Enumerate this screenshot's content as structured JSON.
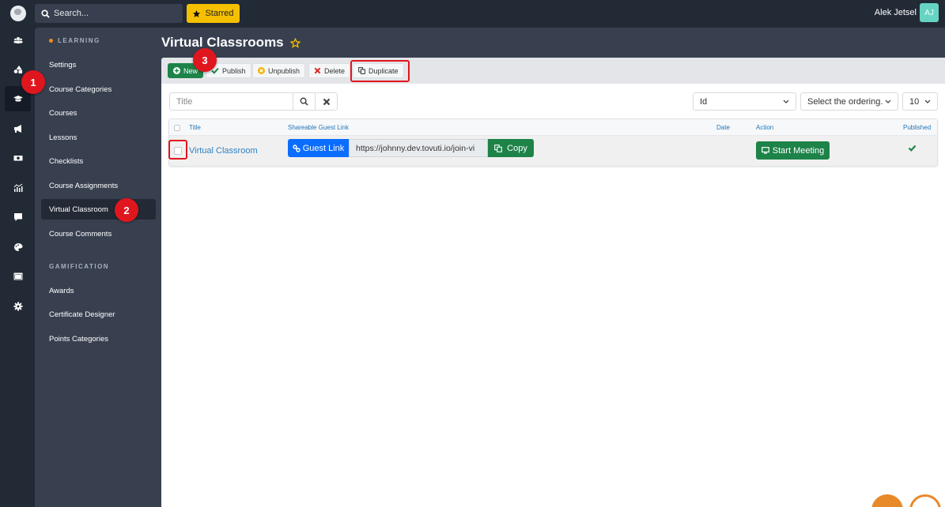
{
  "topbar": {
    "search_placeholder": "Search...",
    "starred_label": "Starred",
    "user_name": "Alek Jetsel",
    "user_initials": "AJ"
  },
  "rail": {
    "items": [
      {
        "icon": "users-icon"
      },
      {
        "icon": "shapes-icon"
      },
      {
        "icon": "graduation-cap-icon",
        "active": true
      },
      {
        "icon": "megaphone-icon"
      },
      {
        "icon": "money-bill-icon"
      },
      {
        "icon": "chart-icon"
      },
      {
        "icon": "comment-icon"
      },
      {
        "icon": "palette-icon"
      },
      {
        "icon": "window-icon"
      },
      {
        "icon": "gear-icon"
      }
    ]
  },
  "subnav": {
    "sections": [
      {
        "label": "LEARNING",
        "items": [
          "Settings",
          "Course Categories",
          "Courses",
          "Lessons",
          "Checklists",
          "Course Assignments",
          "Virtual Classroom",
          "Course Comments"
        ]
      },
      {
        "label": "GAMIFICATION",
        "items": [
          "Awards",
          "Certificate Designer",
          "Points Categories"
        ]
      }
    ],
    "active_item": "Virtual Classroom"
  },
  "page": {
    "title": "Virtual Classrooms"
  },
  "toolbar": {
    "new_label": "New",
    "publish_label": "Publish",
    "unpublish_label": "Unpublish",
    "delete_label": "Delete",
    "duplicate_label": "Duplicate"
  },
  "filters": {
    "title_placeholder": "Title",
    "sort_field": "Id",
    "ordering_placeholder": "Select the ordering.",
    "limit": "10"
  },
  "table": {
    "columns": [
      "Title",
      "Shareable Guest Link",
      "Date",
      "Action",
      "Published"
    ],
    "rows": [
      {
        "title": "Virtual Classroom",
        "guest_link_label": "Guest Link",
        "guest_link_url": "https://johnny.dev.tovuti.io/join-vi",
        "copy_label": "Copy",
        "date": "",
        "action_label": "Start Meeting",
        "published": true
      }
    ]
  },
  "annotations": [
    "1",
    "2",
    "3"
  ],
  "colors": {
    "accent_green": "#1d8348",
    "link_blue": "#2e82c4",
    "primary_blue": "#0b6dfd",
    "starred_yellow": "#f5c000",
    "annotation_red": "#e0161e",
    "sidebar_dark": "#222a36",
    "sidebar": "#384050"
  }
}
